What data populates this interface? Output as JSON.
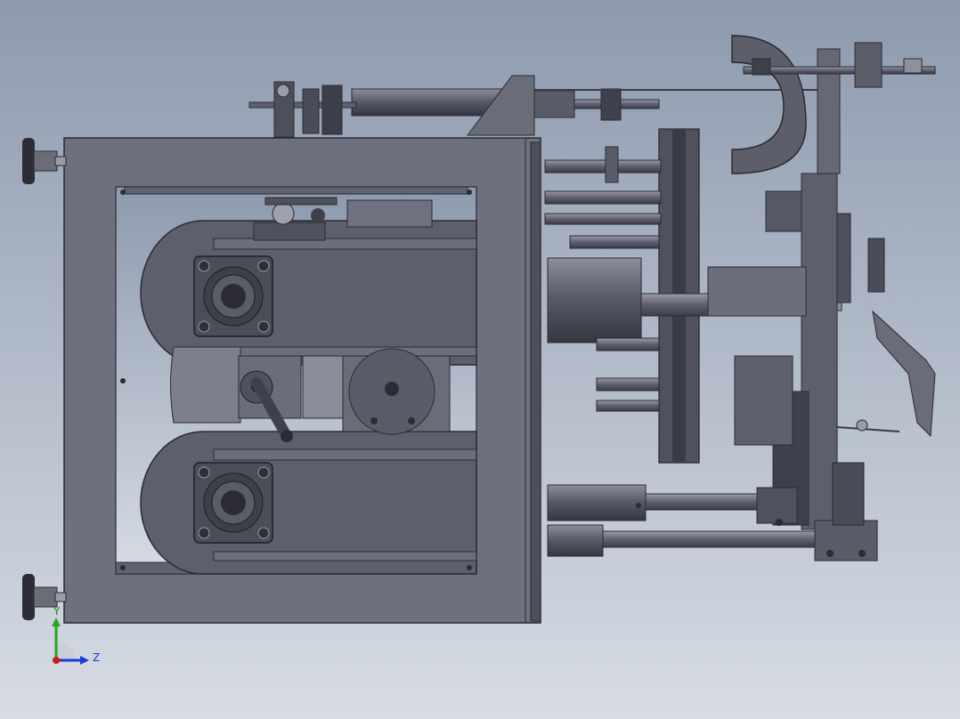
{
  "viewport": {
    "background_top": "#8d9aae",
    "background_bottom": "#d7dce4",
    "model": "machine-assembly"
  },
  "colors": {
    "frame": "#6b6e7e",
    "frame_dark": "#3a3c46",
    "frame_light": "#8a8d9c",
    "panel": "#5b5d6a",
    "edge": "#2a2b32",
    "bearing": "#4a4c56",
    "motor": "#7a7c88"
  },
  "triad": {
    "y_label": "Y",
    "z_label": "Z",
    "y_color": "#1fa81f",
    "z_color": "#1a3bd6",
    "x_color": "#c81e1e"
  }
}
